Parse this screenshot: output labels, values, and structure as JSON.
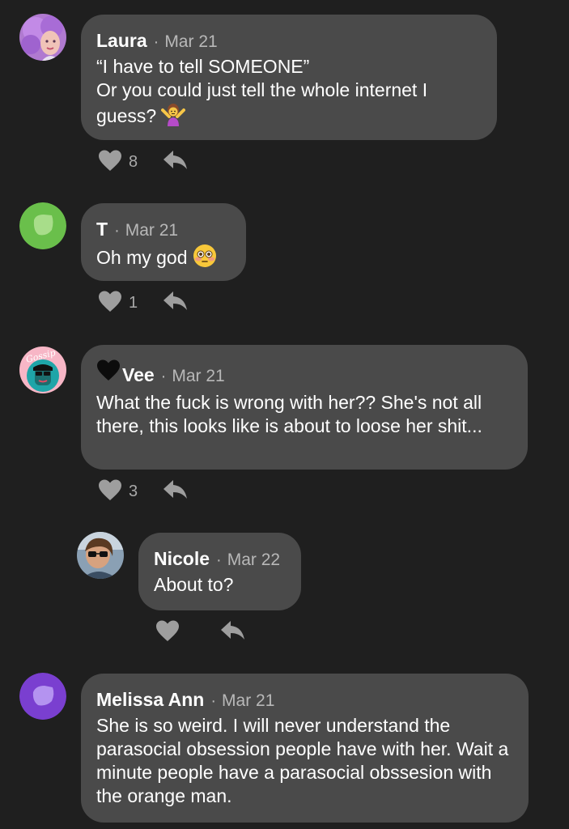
{
  "colors": {
    "background": "#1f1f1f",
    "bubble": "#4a4a4a",
    "text": "#ffffff",
    "meta": "#b8b8b8",
    "action_icon": "#9e9e9e"
  },
  "separator": "·",
  "comments": [
    {
      "author": "Laura",
      "date": "Mar 21",
      "text": "“I have to tell SOMEONE”\nOr you could just tell the whole internet I guess?",
      "emoji": "woman-shrugging-emoji",
      "likes": "8"
    },
    {
      "author": "T",
      "date": "Mar 21",
      "text": "Oh my god",
      "emoji": "flushed-face-emoji",
      "likes": "1"
    },
    {
      "author": "Vee",
      "author_prefix_icon": "black-heart-icon",
      "avatar_text": "Gossip",
      "date": "Mar 21",
      "text": "What the fuck is wrong with her?? She's not all there, this looks like is about to loose her shit...",
      "likes": "3"
    },
    {
      "author": "Nicole",
      "date": "Mar 22",
      "text": "About to?",
      "likes": ""
    },
    {
      "author": "Melissa Ann",
      "date": "Mar 21",
      "text": "She is so weird.  I will never understand the parasocial obsession people have with her. Wait a minute people have a parasocial obssesion with the orange man.",
      "likes": ""
    }
  ]
}
